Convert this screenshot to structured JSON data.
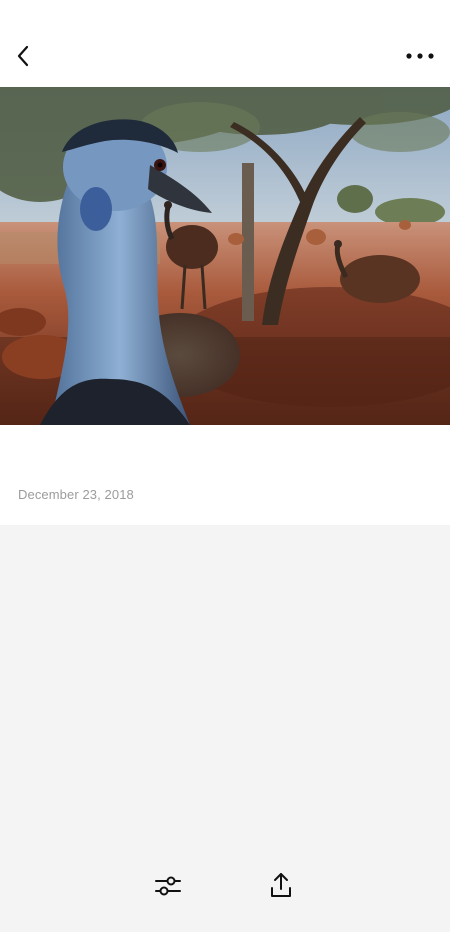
{
  "header": {
    "back_icon": "chevron-left-icon",
    "more_icon": "more-horizontal-icon"
  },
  "photo": {
    "subject": "emu-photo"
  },
  "details": {
    "date": "December 23, 2018"
  },
  "toolbar": {
    "adjust_icon": "sliders-icon",
    "share_icon": "share-upload-icon"
  },
  "colors": {
    "text_muted": "#9c9c9c",
    "icon": "#111111",
    "panel_bg": "#f4f4f4",
    "sky": "#9fb6cf",
    "ground": "#9a4a2c"
  }
}
